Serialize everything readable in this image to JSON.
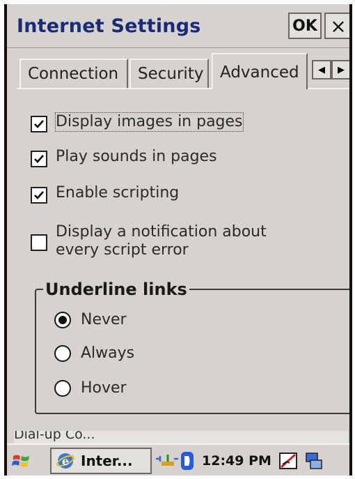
{
  "window": {
    "title": "Internet Settings",
    "ok_label": "OK",
    "close_label": "×"
  },
  "tabs": [
    {
      "label": "Connection"
    },
    {
      "label": "Security"
    },
    {
      "label": "Advanced",
      "active": true
    }
  ],
  "tab_scroll": {
    "left_icon": "◀",
    "right_icon": "▶"
  },
  "options": [
    {
      "label": "Display images in pages",
      "checked": true
    },
    {
      "label": "Play sounds in pages",
      "checked": true
    },
    {
      "label": "Enable scripting",
      "checked": true
    },
    {
      "label_line1": "Display a notification about",
      "label_line2": "every script error",
      "checked": false
    }
  ],
  "underline_links": {
    "title": "Underline links",
    "choices": [
      {
        "label": "Never",
        "selected": true
      },
      {
        "label": "Always",
        "selected": false
      },
      {
        "label": "Hover",
        "selected": false
      }
    ]
  },
  "background_window": {
    "partial_text": "Dial-up Co..."
  },
  "taskbar": {
    "active_task": "Inter...",
    "time": "12:49 PM"
  },
  "colors": {
    "title_text": "#1a2a78",
    "face": "#d6d3ce"
  }
}
